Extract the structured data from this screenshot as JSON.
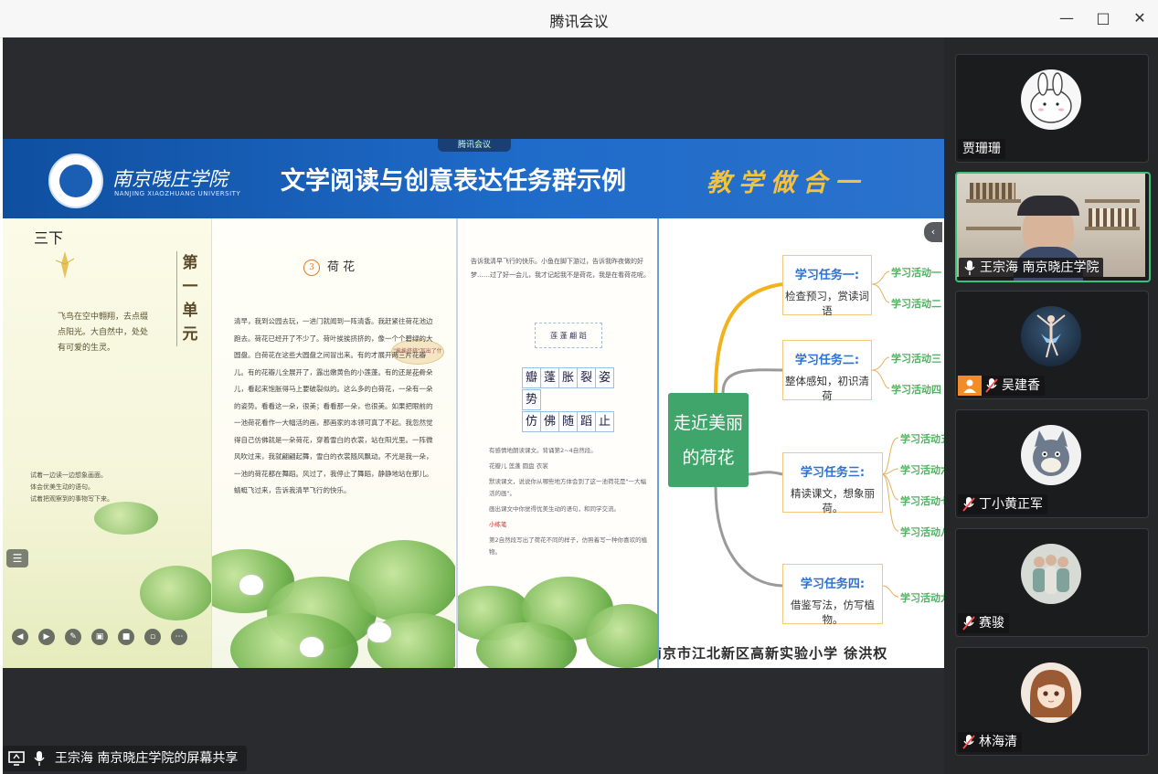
{
  "window": {
    "title": "腾讯会议"
  },
  "share": {
    "mini_label": "腾讯会议",
    "presenter_label": "王宗海 南京晓庄学院的屏幕共享"
  },
  "slide": {
    "school_cn": "南京晓庄学院",
    "school_en": "NANJING XIAOZHUANG UNIVERSITY",
    "title": "文学阅读与创意表达任务群示例",
    "tag": "教学做合一",
    "footer_credit": "南京市江北新区高新实验小学 徐洪权"
  },
  "page1": {
    "grade_label": "三下",
    "unit_title": "第一单元",
    "poem": "飞鸟在空中翱翔，去点缀点阳光。大自然中，处处有可爱的生灵。",
    "notes": [
      "试着一边读一边想象画面。",
      "体会优美生动的语句。",
      "试着把观察到的事物写下来。"
    ]
  },
  "page2": {
    "lesson_number": "3",
    "lesson_title": "荷 花",
    "bubble": "\"挨挨挤挤\"写出了什么？",
    "text": "清早，我到公园去玩，一进门就闻到一阵清香。我赶紧往荷花池边跑去。荷花已经开了不少了。荷叶挨挨挤挤的，像一个个碧绿的大圆盘。白荷花在这些大圆盘之间冒出来。有的才展开两三片花瓣儿。有的花瓣儿全展开了，露出嫩黄色的小莲蓬。有的还是花骨朵儿，看起来饱胀得马上要破裂似的。这么多的白荷花，一朵有一朵的姿势。看看这一朵，很美；看看那一朵，也很美。如果把眼前的一池荷花看作一大幅活的画，那画家的本领可真了不起。我忽然觉得自己仿佛就是一朵荷花，穿着雪白的衣裳，站在阳光里。一阵微风吹过来，我就翩翩起舞，雪白的衣裳随风飘动。不光是我一朵，一池的荷花都在舞蹈。风过了，我停止了舞蹈，静静地站在那儿。蜻蜓飞过来，告诉我清早飞行的快乐。"
  },
  "page3": {
    "text": "告诉我清早飞行的快乐。小鱼在脚下游过，告诉我昨夜做的好梦……过了好一会儿，我才记起我不是荷花，我是在看荷花呢。",
    "word_box": "莲 蓬 翩 蹈",
    "characters": [
      "瓣",
      "蓬",
      "胀",
      "裂",
      "姿",
      "势",
      "仿",
      "佛",
      "随",
      "蹈",
      "止"
    ],
    "questions": [
      "有感情地朗读课文。背诵第2~4自然段。",
      "花瓣儿  莲蓬  圆盘  衣裳",
      "默读课文，说说你从哪些地方体会到了这一池荷花是\"一大幅活的画\"。",
      "画出课文中你觉得优美生动的语句，和同学交流。",
      "小练笔",
      "第2自然段写出了荷花不同的样子，仿照着写一种你喜欢的植物。"
    ]
  },
  "mindmap": {
    "center": "走近美丽的荷花",
    "tasks": [
      {
        "title": "学习任务一:",
        "desc": "检查预习，赏读词语",
        "activities": [
          "学习活动一",
          "学习活动二"
        ]
      },
      {
        "title": "学习任务二:",
        "desc": "整体感知，初识清荷",
        "activities": [
          "学习活动三",
          "学习活动四"
        ]
      },
      {
        "title": "学习任务三:",
        "desc": "精读课文，想象丽荷。",
        "activities": [
          "学习活动五",
          "学习活动六",
          "学习活动七",
          "学习活动八"
        ]
      },
      {
        "title": "学习任务四:",
        "desc": "借鉴写法，仿写植物。",
        "activities": [
          "学习活动九"
        ]
      }
    ]
  },
  "participants": [
    {
      "name": "贾珊珊",
      "muted": false,
      "show_mic": false
    },
    {
      "name": "王宗海 南京晓庄学院",
      "muted": false,
      "show_mic": true,
      "speaking": true
    },
    {
      "name": "吴建香",
      "muted": true,
      "show_mic": true
    },
    {
      "name": "丁小黄正军",
      "muted": true,
      "show_mic": true
    },
    {
      "name": "赛骏",
      "muted": true,
      "show_mic": true
    },
    {
      "name": "林海清",
      "muted": true,
      "show_mic": true
    }
  ],
  "colors": {
    "banner": "#1f6bc9",
    "accent_green": "#3fa56a",
    "task_blue": "#2b72d6",
    "activity_green": "#4fb35f",
    "active_tile": "#39c27a"
  }
}
